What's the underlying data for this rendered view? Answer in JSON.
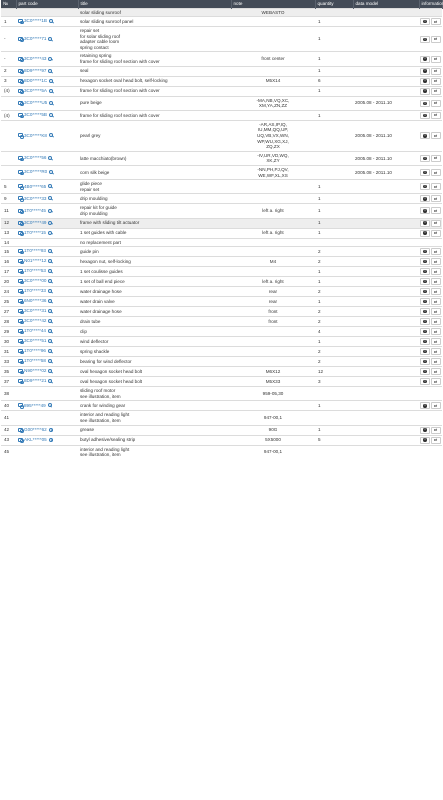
{
  "columns": [
    "№",
    "part code",
    "title",
    "note",
    "quantity",
    "data model",
    "information"
  ],
  "icons": {
    "photo": "camera-icon",
    "search": "magnifier-icon",
    "info": "info-circle-icon",
    "swap": "swap-arrows-icon"
  },
  "colors": {
    "header_bg": "#434b57",
    "link": "#337ab7",
    "shaded_row": "#eeeeee"
  },
  "rows": [
    {
      "nr": "",
      "code": "",
      "title": "solar sliding sunroof",
      "note": "WEBASTO",
      "qty": "",
      "date": "",
      "shaded": true,
      "buttons": false,
      "camera": false
    },
    {
      "nr": "1",
      "code": "3C0*****1B",
      "title": "solar sliding sunroof panel",
      "note": "",
      "qty": "1",
      "date": "",
      "shaded": false,
      "buttons": true,
      "camera": true
    },
    {
      "nr": "-",
      "code": "3C0*****71",
      "title": "repair set\nfor solar sliding roof\nadapter cable loom\nspring contact",
      "note": "",
      "qty": "1",
      "date": "",
      "shaded": false,
      "buttons": true,
      "camera": true
    },
    {
      "nr": "-",
      "code": "3C0*****43",
      "title": "retaining spring\nframe for sliding roof section with cover",
      "note": "front center",
      "qty": "1",
      "date": "",
      "shaded": false,
      "buttons": true,
      "camera": true
    },
    {
      "nr": "2",
      "code": "8D9*****97",
      "title": "seal",
      "note": "",
      "qty": "1",
      "date": "",
      "shaded": false,
      "buttons": true,
      "camera": true
    },
    {
      "nr": "3",
      "code": "8D0*****1C",
      "title": "hexagon socket oval head bolt, self-locking",
      "note": "M5X14",
      "qty": "6",
      "date": "",
      "shaded": false,
      "buttons": true,
      "camera": true
    },
    {
      "nr": "(4)",
      "code": "3C0*****5A",
      "title": "frame for sliding roof section with cover",
      "note": "",
      "qty": "1",
      "date": "",
      "shaded": false,
      "buttons": true,
      "camera": true
    },
    {
      "nr": "",
      "code": "3C0*****U5",
      "title": "pure beige",
      "note": "-MA,NB,VQ,XC,\nXM,YA,ZN,ZZ",
      "qty": "",
      "date": "2005.08 - 2011.10",
      "shaded": false,
      "buttons": true,
      "camera": true
    },
    {
      "nr": "(4)",
      "code": "3C0*****5B",
      "title": "frame for sliding roof section with cover",
      "note": "",
      "qty": "1",
      "date": "",
      "shaded": false,
      "buttons": true,
      "camera": true
    },
    {
      "nr": "",
      "code": "3C0*****K8",
      "title": "pearl grey",
      "note": "-AR,AS,IP,IQ,\nIU,MM,QQ,UP,\nUQ,VB,VX,WN,\nWP,WU,XG,XJ,\nZQ,ZX",
      "qty": "",
      "date": "2005.08 - 2011.10",
      "shaded": false,
      "buttons": true,
      "camera": true
    },
    {
      "nr": "",
      "code": "3C0*****56",
      "title": "latte macchiato(brown)",
      "note": "-IV,UR,VD,WQ,\nXK,ZY",
      "qty": "",
      "date": "2005.08 - 2011.10",
      "shaded": false,
      "buttons": true,
      "camera": true
    },
    {
      "nr": "",
      "code": "3C0*****R0",
      "title": "corn silk beige",
      "note": "-NN,PH,PJ,QV,\nWE,WF,XL,XS",
      "qty": "",
      "date": "2005.08 - 2011.10",
      "shaded": false,
      "buttons": true,
      "camera": true
    },
    {
      "nr": "5",
      "code": "4B0*****65",
      "title": "glide piece\nrepair set",
      "note": "",
      "qty": "1",
      "date": "",
      "shaded": false,
      "buttons": true,
      "camera": true
    },
    {
      "nr": "9",
      "code": "3C0*****33",
      "title": "drip moulding",
      "note": "",
      "qty": "1",
      "date": "",
      "shaded": false,
      "buttons": true,
      "camera": true
    },
    {
      "nr": "11",
      "code": "1T0*****45",
      "title": "repair kit for guide\ndrip moulding",
      "note": "left a. right",
      "qty": "1",
      "date": "",
      "shaded": false,
      "buttons": true,
      "camera": true
    },
    {
      "nr": "12",
      "code": "3C0*****49",
      "title": "frame with sliding tilt actuator",
      "note": "",
      "qty": "1",
      "date": "",
      "shaded": true,
      "buttons": true,
      "camera": true
    },
    {
      "nr": "13",
      "code": "1T0*****15",
      "title": "1 set guides with cable",
      "note": "left a. right",
      "qty": "1",
      "date": "",
      "shaded": false,
      "buttons": true,
      "camera": true
    },
    {
      "nr": "14",
      "code": "",
      "title": "no replacement part",
      "note": "",
      "qty": "",
      "date": "",
      "shaded": false,
      "buttons": false,
      "camera": false
    },
    {
      "nr": "15",
      "code": "1T0*****93",
      "title": "guide pin",
      "note": "",
      "qty": "2",
      "date": "",
      "shaded": false,
      "buttons": true,
      "camera": true
    },
    {
      "nr": "16",
      "code": "N01*****12",
      "title": "hexagon nut, self-locking",
      "note": "M4",
      "qty": "2",
      "date": "",
      "shaded": false,
      "buttons": true,
      "camera": true
    },
    {
      "nr": "17",
      "code": "1T0*****53",
      "title": "1 set coulisse guides",
      "note": "",
      "qty": "1",
      "date": "",
      "shaded": false,
      "buttons": true,
      "camera": true
    },
    {
      "nr": "20",
      "code": "3C0*****00",
      "title": "1 set of ball end piece",
      "note": "left a. right",
      "qty": "1",
      "date": "",
      "shaded": false,
      "buttons": true,
      "camera": true
    },
    {
      "nr": "24",
      "code": "1T0*****33",
      "title": "water drainage hose",
      "note": "rear",
      "qty": "2",
      "date": "",
      "shaded": false,
      "buttons": true,
      "camera": true
    },
    {
      "nr": "25",
      "code": "6N0*****36",
      "title": "water drain valve",
      "note": "rear",
      "qty": "1",
      "date": "",
      "shaded": false,
      "buttons": true,
      "camera": true
    },
    {
      "nr": "27",
      "code": "3C0*****31",
      "title": "water drainage hose",
      "note": "front",
      "qty": "2",
      "date": "",
      "shaded": false,
      "buttons": true,
      "camera": true
    },
    {
      "nr": "28",
      "code": "3C0*****42",
      "title": "drain tube",
      "note": "front",
      "qty": "2",
      "date": "",
      "shaded": false,
      "buttons": true,
      "camera": true
    },
    {
      "nr": "29",
      "code": "1T0*****44",
      "title": "clip",
      "note": "",
      "qty": "4",
      "date": "",
      "shaded": false,
      "buttons": true,
      "camera": true
    },
    {
      "nr": "30",
      "code": "3C0*****51",
      "title": "wind deflector",
      "note": "",
      "qty": "1",
      "date": "",
      "shaded": false,
      "buttons": true,
      "camera": true
    },
    {
      "nr": "31",
      "code": "1T0*****96",
      "title": "spring shackle",
      "note": "",
      "qty": "2",
      "date": "",
      "shaded": false,
      "buttons": true,
      "camera": true
    },
    {
      "nr": "33",
      "code": "1T0*****58",
      "title": "bearing for wind deflector",
      "note": "",
      "qty": "2",
      "date": "",
      "shaded": false,
      "buttons": true,
      "camera": true
    },
    {
      "nr": "35",
      "code": "N90*****02",
      "title": "oval hexagon socket head bolt",
      "note": "M6X12",
      "qty": "12",
      "date": "",
      "shaded": false,
      "buttons": true,
      "camera": true
    },
    {
      "nr": "37",
      "code": "8D9*****21",
      "title": "oval hexagon socket head bolt",
      "note": "M5X33",
      "qty": "3",
      "date": "",
      "shaded": false,
      "buttons": true,
      "camera": true
    },
    {
      "nr": "38",
      "code": "",
      "title": "sliding roof motor\nsee illustration, item",
      "note": "959-05,30",
      "qty": "",
      "date": "",
      "shaded": false,
      "buttons": false,
      "camera": false
    },
    {
      "nr": "40",
      "code": "895*****49",
      "title": "crank for winding gear",
      "note": "",
      "qty": "1",
      "date": "",
      "shaded": false,
      "buttons": true,
      "camera": true
    },
    {
      "nr": "41",
      "code": "",
      "title": "interior and reading light\nsee illustration, item",
      "note": "947-00,1",
      "qty": "",
      "date": "",
      "shaded": false,
      "buttons": false,
      "camera": false
    },
    {
      "nr": "42",
      "code": "G00*****62",
      "title": "grease",
      "note": "90G",
      "qty": "1",
      "date": "",
      "shaded": false,
      "buttons": true,
      "camera": true
    },
    {
      "nr": "43",
      "code": "AKL*****05",
      "title": "butyl adhesive/sealing strip",
      "note": "5X5000",
      "qty": "5",
      "date": "",
      "shaded": false,
      "buttons": true,
      "camera": true
    },
    {
      "nr": "45",
      "code": "",
      "title": "interior and reading light\nsee illustration, item",
      "note": "947-00,1",
      "qty": "",
      "date": "",
      "shaded": false,
      "buttons": false,
      "camera": false
    }
  ]
}
